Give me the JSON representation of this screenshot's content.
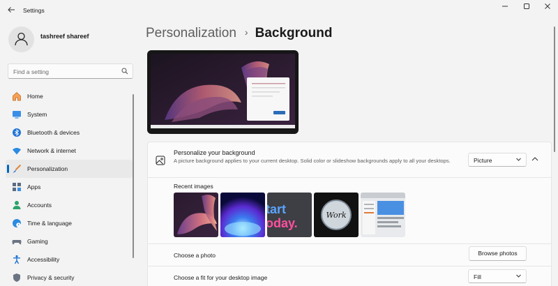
{
  "window": {
    "title": "Settings",
    "controls": [
      "minimize-icon",
      "maximize-icon",
      "close-icon"
    ]
  },
  "profile": {
    "name": "tashreef shareef"
  },
  "search": {
    "placeholder": "Find a setting"
  },
  "nav": {
    "active_index": 4,
    "accent_color": "#0067c0",
    "items": [
      {
        "label": "Home",
        "icon": "home-icon"
      },
      {
        "label": "System",
        "icon": "monitor-icon"
      },
      {
        "label": "Bluetooth & devices",
        "icon": "bluetooth-icon"
      },
      {
        "label": "Network & internet",
        "icon": "wifi-icon"
      },
      {
        "label": "Personalization",
        "icon": "brush-icon"
      },
      {
        "label": "Apps",
        "icon": "apps-icon"
      },
      {
        "label": "Accounts",
        "icon": "person-icon"
      },
      {
        "label": "Time & language",
        "icon": "globe-clock-icon"
      },
      {
        "label": "Gaming",
        "icon": "gamepad-icon"
      },
      {
        "label": "Accessibility",
        "icon": "accessibility-icon"
      },
      {
        "label": "Privacy & security",
        "icon": "shield-icon"
      }
    ]
  },
  "breadcrumb": {
    "parent": "Personalization",
    "separator": "›",
    "current": "Background"
  },
  "background_card": {
    "title": "Personalize your background",
    "description": "A picture background applies to your current desktop. Solid color or slideshow backgrounds apply to all your desktops.",
    "type_value": "Picture",
    "recent_images_label": "Recent images",
    "recent_images": [
      {
        "name": "bloom-dark-thumbnail"
      },
      {
        "name": "blue-bloom-thumbnail"
      },
      {
        "name": "start-today-thumbnail",
        "text_top": "tart",
        "text_bottom": "oday."
      },
      {
        "name": "work-circle-thumbnail",
        "text": "Work"
      },
      {
        "name": "screenshot-thumbnail"
      }
    ],
    "choose_photo_label": "Choose a photo",
    "browse_button": "Browse photos",
    "fit_label": "Choose a fit for your desktop image",
    "fit_value": "Fill"
  }
}
